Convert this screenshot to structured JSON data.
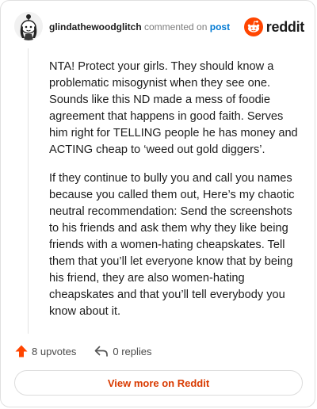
{
  "header": {
    "username": "glindathewoodglitch",
    "commented_text": "commented on",
    "post_link": "post",
    "brand": "reddit"
  },
  "comment": {
    "paragraphs": [
      "NTA! Protect your girls. They should know a problematic misogynist when they see one. Sounds like this ND made a mess of foodie agreement that happens in good faith. Serves him right for TELLING people he has money and ACTING cheap to ‘weed out gold diggers’.",
      "If they continue to bully you and call you names because you called them out, Here’s my chaotic neutral recommendation: Send the screenshots to his friends and ask them why they like being friends with a women-hating cheapskates. Tell them that you’ll let everyone know that by being his friend, they are also women-hating cheapskates and that you’ll tell everybody you know about it."
    ]
  },
  "actions": {
    "upvotes": "8 upvotes",
    "replies": "0 replies"
  },
  "footer": {
    "view_more": "View more on Reddit"
  },
  "colors": {
    "accent": "#ff4500",
    "link": "#0079d3",
    "view_more_text": "#d93a00"
  },
  "icons": {
    "upvote": "upvote-arrow-icon",
    "reply": "reply-arrow-icon",
    "brand": "reddit-snoo-icon"
  }
}
